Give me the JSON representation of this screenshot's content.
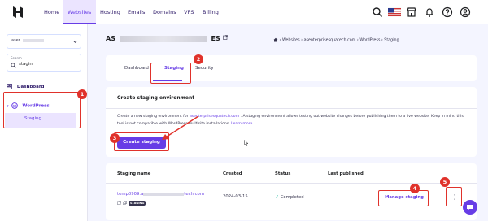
{
  "topnav": {
    "items": [
      "Home",
      "Websites",
      "Hosting",
      "Emails",
      "Domains",
      "VPS",
      "Billing"
    ],
    "active": "Websites"
  },
  "sidebar": {
    "site_select": "aser",
    "search_label": "Search",
    "search_value": "stagin",
    "dashboard": "Dashboard",
    "wordpress": "WordPress",
    "staging": "Staging"
  },
  "header": {
    "title_start": "AS",
    "title_end": "ES",
    "breadcrumb": "› Websites › asenterprisesquatech.com › WordPress › Staging"
  },
  "tabs": [
    "Dashboard",
    "Staging",
    "Security"
  ],
  "create_card": {
    "title": "Create staging environment",
    "desc_pre": "Create a new staging environment for ",
    "desc_link1": "asenterprisesquatech.com",
    "desc_mid": ". A staging environment allows testing out website changes before publishing them to a live website. Keep in mind this tool is not compatible with WordPress multisite installations. ",
    "desc_link2": "Learn more",
    "button": "Create staging"
  },
  "table": {
    "headers": [
      "Staging name",
      "Created",
      "Status",
      "Last published"
    ],
    "row": {
      "name_start": "temp0909.a",
      "name_end": "tech.com",
      "tag": "STAGING",
      "created": "2024-03-15",
      "status": "Completed",
      "manage": "Manage staging"
    }
  },
  "callouts": [
    "1",
    "2",
    "3",
    "4",
    "5"
  ],
  "colors": {
    "accent": "#673de6",
    "highlight": "#e0322b",
    "success": "#00b090"
  }
}
